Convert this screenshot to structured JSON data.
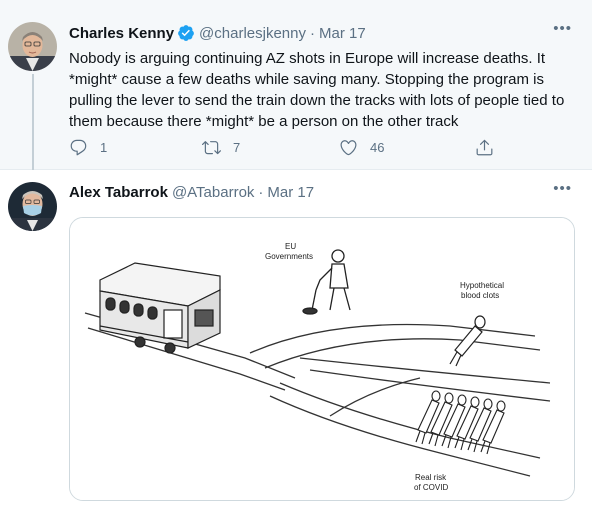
{
  "tweet1": {
    "name": "Charles Kenny",
    "handle": "@charlesjkenny",
    "separator": "·",
    "date": "Mar 17",
    "text": "Nobody is arguing continuing AZ shots in Europe will increase deaths. It *might* cause a few deaths while saving many. Stopping the program is pulling the lever to send the train down the tracks with lots of people tied to them because there *might* be a person on the other track",
    "replies": "1",
    "retweets": "7",
    "likes": "46",
    "more": "•••"
  },
  "tweet2": {
    "name": "Alex Tabarrok",
    "handle": "@ATabarrok",
    "separator": "·",
    "date": "Mar 17",
    "more": "•••",
    "image_labels": {
      "eu": "EU Governments",
      "eu_line1": "EU",
      "eu_line2": "Governments",
      "hyp_line1": "Hypothetical",
      "hyp_line2": "blood clots",
      "covid_line1": "Real risk",
      "covid_line2": "of COVID"
    }
  },
  "colors": {
    "verified": "#1da1f2",
    "muted": "#5b7083",
    "thread_bg": "#f5f8fa"
  },
  "icons": [
    "reply-icon",
    "retweet-icon",
    "like-icon",
    "share-icon",
    "verified-icon",
    "more-icon"
  ]
}
